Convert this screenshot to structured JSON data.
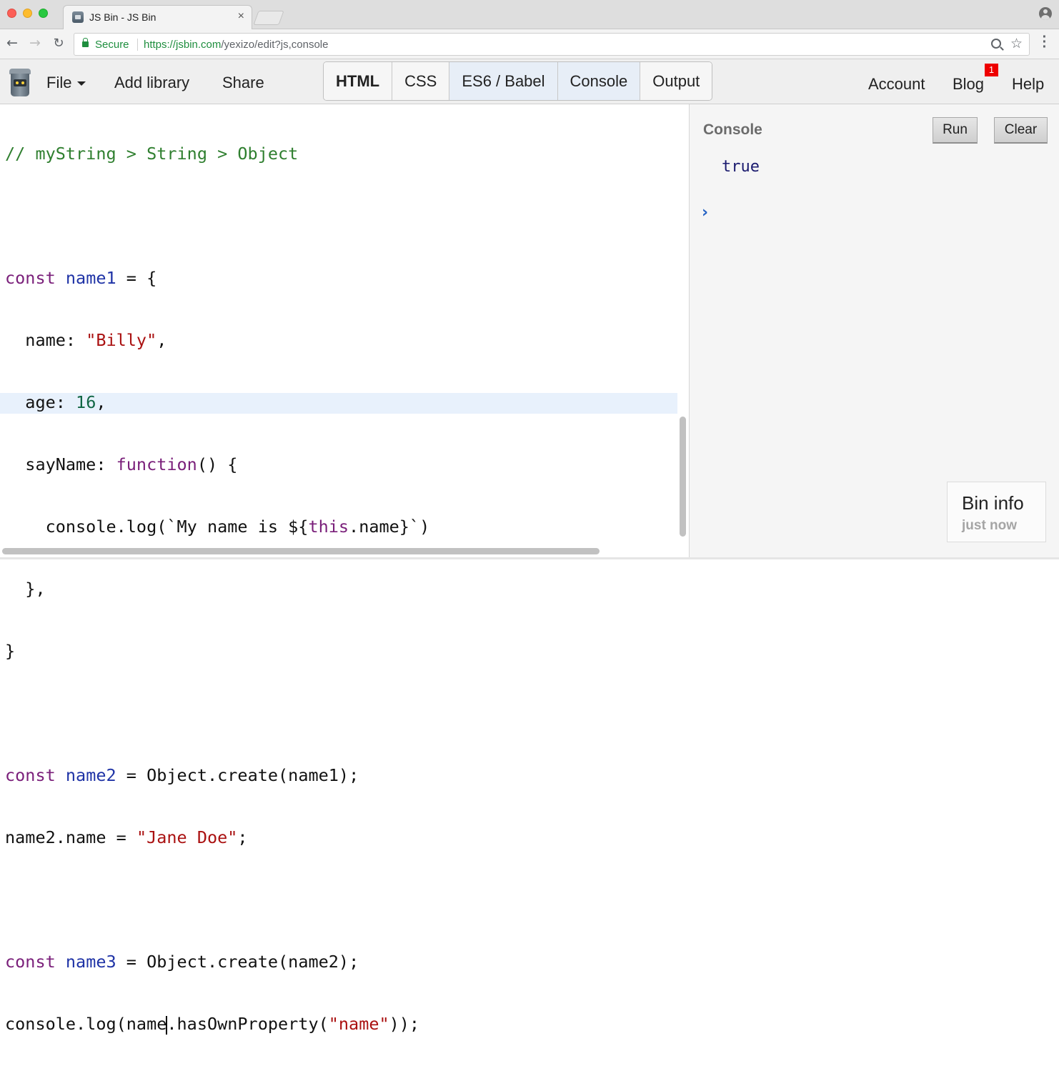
{
  "browser": {
    "tab_title": "JS Bin - JS Bin",
    "tab_close": "×",
    "secure_label": "Secure",
    "url_host": "https://jsbin.com",
    "url_path": "/yexizo/edit?js,console"
  },
  "jsbin": {
    "menu": {
      "file": "File",
      "add_library": "Add library",
      "share": "Share"
    },
    "panels": [
      {
        "label": "HTML",
        "active": false
      },
      {
        "label": "CSS",
        "active": false
      },
      {
        "label": "ES6 / Babel",
        "active": true
      },
      {
        "label": "Console",
        "active": true
      },
      {
        "label": "Output",
        "active": false
      }
    ],
    "right_links": {
      "account": "Account",
      "blog": "Blog",
      "blog_badge": "1",
      "help": "Help"
    }
  },
  "editor": {
    "language": "ES6 / Babel",
    "active_line": 15,
    "lines": [
      "// myString > String > Object",
      "",
      "const name1 = {",
      "  name: \"Billy\",",
      "  age: 16,",
      "  sayName: function() {",
      "    console.log(`My name is ${this.name}`)",
      "  },",
      "}",
      "",
      "const name2 = Object.create(name1);",
      "name2.name = \"Jane Doe\";",
      "",
      "const name3 = Object.create(name2);",
      "console.log(name.hasOwnProperty(\"name\"));"
    ]
  },
  "console": {
    "title": "Console",
    "run_label": "Run",
    "clear_label": "Clear",
    "output": "true",
    "prompt": "›"
  },
  "bin_info": {
    "title": "Bin info",
    "subtitle": "just now"
  },
  "colors": {
    "comment": "#2f7f2f",
    "keyword": "#7a1f7a",
    "variable": "#1f33a6",
    "string": "#aa1111",
    "number": "#116644",
    "active_line_bg": "#e8f1fc",
    "active_panel_bg": "#e7eef7"
  }
}
